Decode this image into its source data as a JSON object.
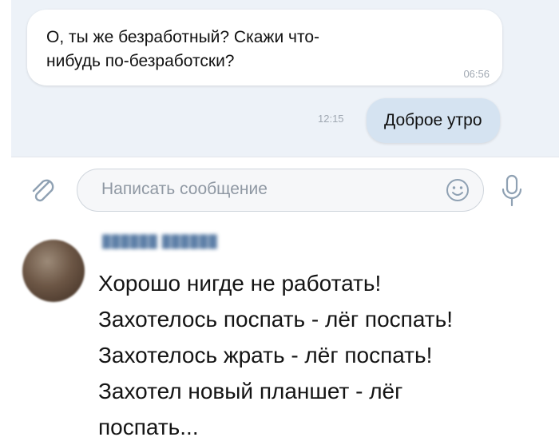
{
  "chat": {
    "incoming": {
      "line1": "О, ты же безработный? Скажи что-",
      "line2": "нибудь по-безработски?",
      "time": "06:56"
    },
    "outgoing": {
      "text": "Доброе утро",
      "time": "12:15"
    }
  },
  "compose": {
    "placeholder": "Написать сообщение",
    "icons": [
      "paperclip-icon",
      "smile-icon",
      "microphone-icon"
    ]
  },
  "comment": {
    "author": "██████ ██████",
    "lines": [
      "Хорошо нигде не работать!",
      "Захотелось поспать - лёг поспать!",
      "Захотелось жрать - лёг поспать!",
      "Захотел новый планшет - лёг",
      "поспать..."
    ]
  },
  "colors": {
    "chat_background": "#edf2f8",
    "outgoing_bubble": "#d5e3f1",
    "link_blue": "#5d7fa7"
  }
}
